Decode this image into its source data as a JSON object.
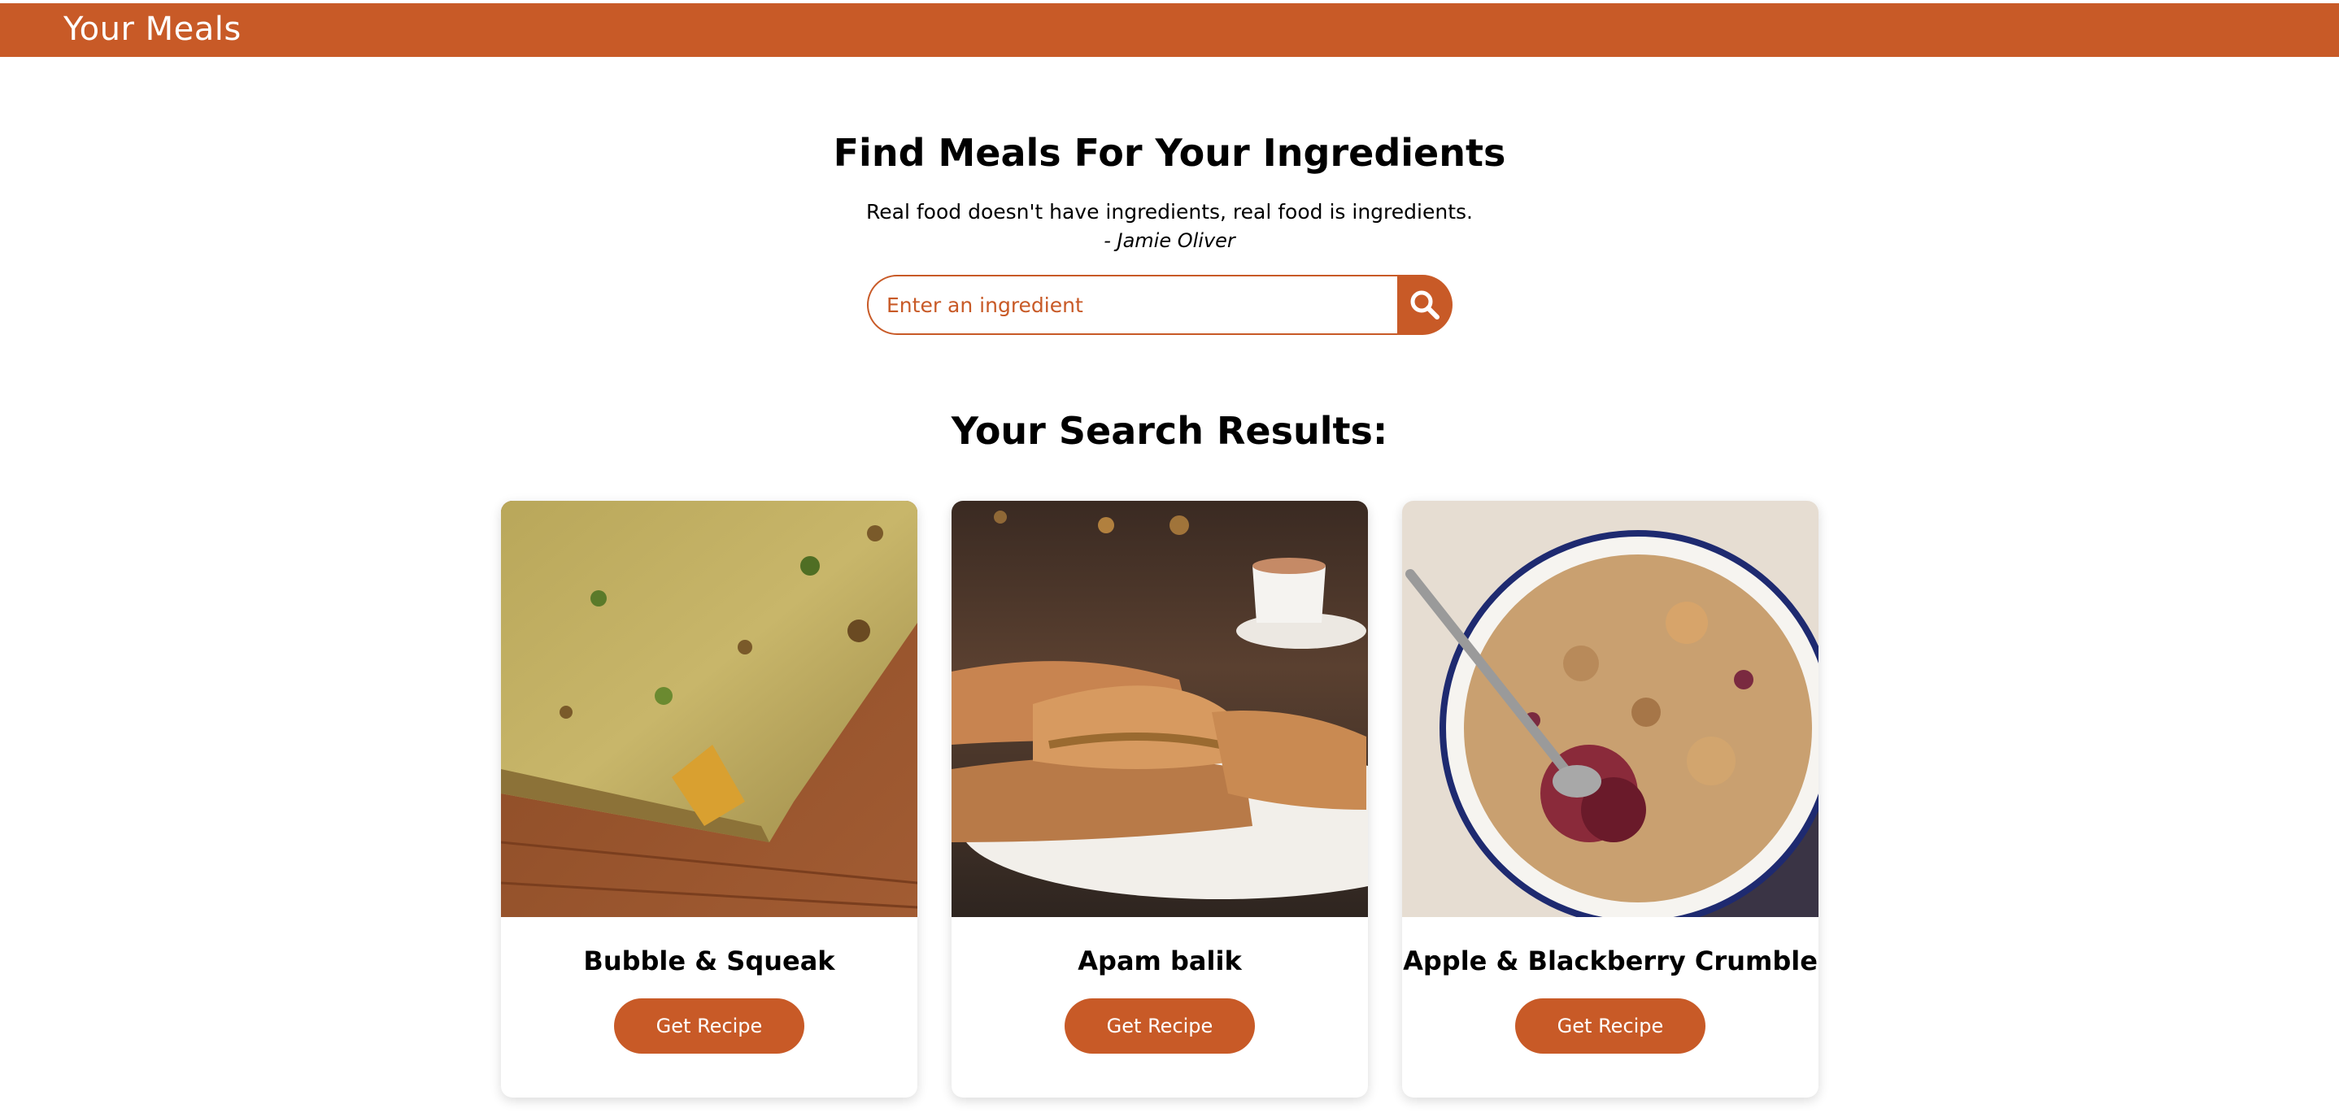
{
  "header": {
    "brand": "Your Meals"
  },
  "hero": {
    "title": "Find Meals For Your Ingredients",
    "quote": "Real food doesn't have ingredients, real food is ingredients.",
    "quote_author": "- Jamie Oliver"
  },
  "search": {
    "placeholder": "Enter an ingredient",
    "value": "",
    "button_icon": "search-icon"
  },
  "results": {
    "title": "Your Search Results:",
    "cards": [
      {
        "name": "Bubble & Squeak",
        "button_label": "Get Recipe",
        "image": "bubble-and-squeak-photo"
      },
      {
        "name": "Apam balik",
        "button_label": "Get Recipe",
        "image": "apam-balik-photo"
      },
      {
        "name": "Apple & Blackberry Crumble",
        "button_label": "Get Recipe",
        "image": "apple-blackberry-crumble-photo"
      }
    ]
  },
  "colors": {
    "accent": "#c85a27",
    "background": "#ffffff",
    "text": "#000000"
  }
}
